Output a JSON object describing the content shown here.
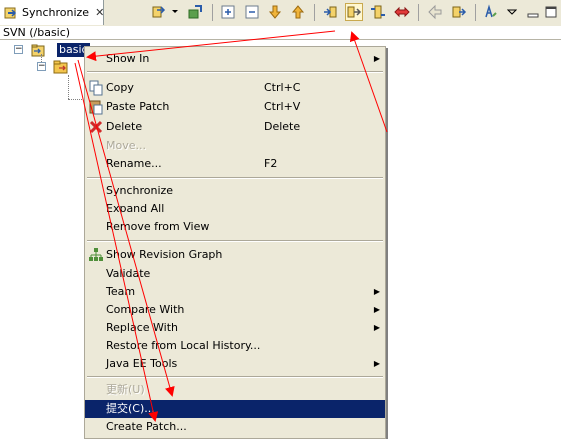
{
  "view": {
    "tab_label": "Synchronize",
    "close_glyph": "✕",
    "path_label": "SVN (/basic)"
  },
  "tree": {
    "root_label": "basic"
  },
  "menu": {
    "items": [
      {
        "label": "Show In",
        "shortcut": "",
        "submenu": true
      },
      {
        "label": "Copy",
        "shortcut": "Ctrl+C",
        "submenu": false
      },
      {
        "label": "Paste Patch",
        "shortcut": "Ctrl+V",
        "submenu": false
      },
      {
        "label": "Delete",
        "shortcut": "Delete",
        "submenu": false
      },
      {
        "label": "Move...",
        "shortcut": "",
        "submenu": false,
        "disabled": true
      },
      {
        "label": "Rename...",
        "shortcut": "F2",
        "submenu": false
      },
      {
        "label": "Synchronize",
        "shortcut": "",
        "submenu": false
      },
      {
        "label": "Expand All",
        "shortcut": "",
        "submenu": false
      },
      {
        "label": "Remove from View",
        "shortcut": "",
        "submenu": false
      },
      {
        "label": "Show Revision Graph",
        "shortcut": "",
        "submenu": false
      },
      {
        "label": "Validate",
        "shortcut": "",
        "submenu": false
      },
      {
        "label": "Team",
        "shortcut": "",
        "submenu": true
      },
      {
        "label": "Compare With",
        "shortcut": "",
        "submenu": true
      },
      {
        "label": "Replace With",
        "shortcut": "",
        "submenu": true
      },
      {
        "label": "Restore from Local History...",
        "shortcut": "",
        "submenu": false
      },
      {
        "label": "Java EE Tools",
        "shortcut": "",
        "submenu": true
      },
      {
        "label": "更新(U)",
        "shortcut": "",
        "submenu": false,
        "disabled": true
      },
      {
        "label": "提交(C)...",
        "shortcut": "",
        "submenu": false,
        "highlighted": true
      },
      {
        "label": "Create Patch...",
        "shortcut": "",
        "submenu": false
      }
    ]
  },
  "colors": {
    "selection": "#0a246a",
    "menu_bg": "#ece9d8",
    "annotation": "#ff0000"
  }
}
